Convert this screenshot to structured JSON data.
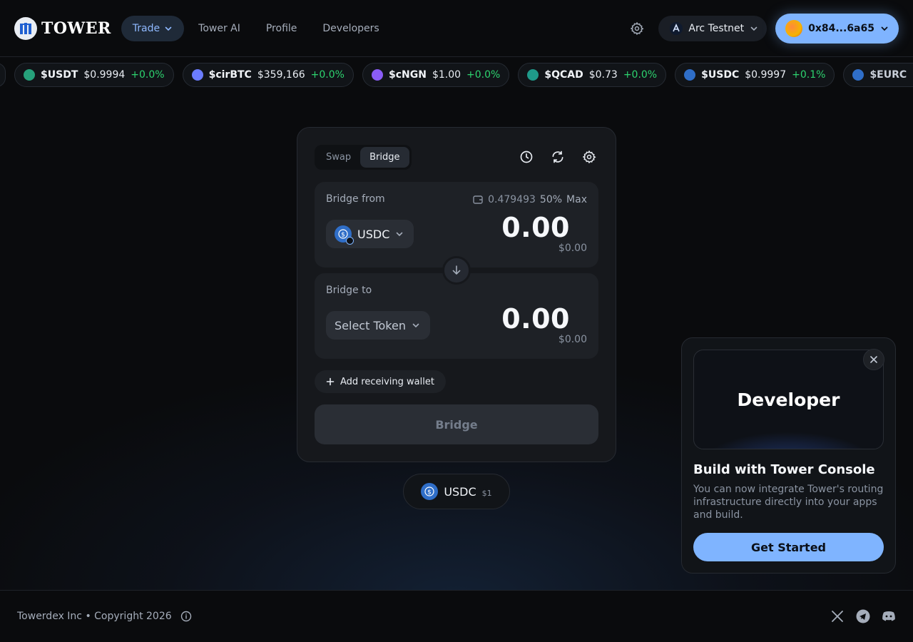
{
  "header": {
    "logo_text": "TOWER",
    "nav": [
      {
        "label": "Trade",
        "active": true
      },
      {
        "label": "Tower AI"
      },
      {
        "label": "Profile"
      },
      {
        "label": "Developers"
      }
    ],
    "network": "Arc Testnet",
    "wallet": "0x84...6a65"
  },
  "ticker": [
    {
      "symbol": "$USDT",
      "price": "$0.9994",
      "change": "+0.0%",
      "color": "#26a17b"
    },
    {
      "symbol": "$cirBTC",
      "price": "$359,166",
      "change": "+0.0%",
      "color": "#6b7cff"
    },
    {
      "symbol": "$cNGN",
      "price": "$1.00",
      "change": "+0.0%",
      "color": "#8a5cf6"
    },
    {
      "symbol": "$QCAD",
      "price": "$0.73",
      "change": "+0.0%",
      "color": "#1f9a8a"
    },
    {
      "symbol": "$USDC",
      "price": "$0.9997",
      "change": "+0.1%",
      "color": "#2f6ec8"
    },
    {
      "symbol": "$EURC",
      "price": "$",
      "change": "",
      "color": "#2f6ec8"
    }
  ],
  "card": {
    "tabs": [
      {
        "label": "Swap",
        "active": false
      },
      {
        "label": "Bridge",
        "active": true
      }
    ],
    "from": {
      "label": "Bridge from",
      "balance": "0.479493",
      "pct": "50%",
      "max": "Max",
      "token": "USDC",
      "amount": "0.00",
      "usd": "$0.00"
    },
    "to": {
      "label": "Bridge to",
      "token": "Select Token",
      "amount": "0.00",
      "usd": "$0.00"
    },
    "add_wallet": "Add receiving wallet",
    "bridge_button": "Bridge"
  },
  "price_pill": {
    "token": "USDC",
    "price": "$1"
  },
  "promo": {
    "hero": "Developer",
    "title": "Build with Tower Console",
    "desc": "You can now integrate Tower's routing infrastructure directly into your apps and build.",
    "cta": "Get Started"
  },
  "footer": {
    "text": "Towerdex Inc • Copyright 2026"
  }
}
